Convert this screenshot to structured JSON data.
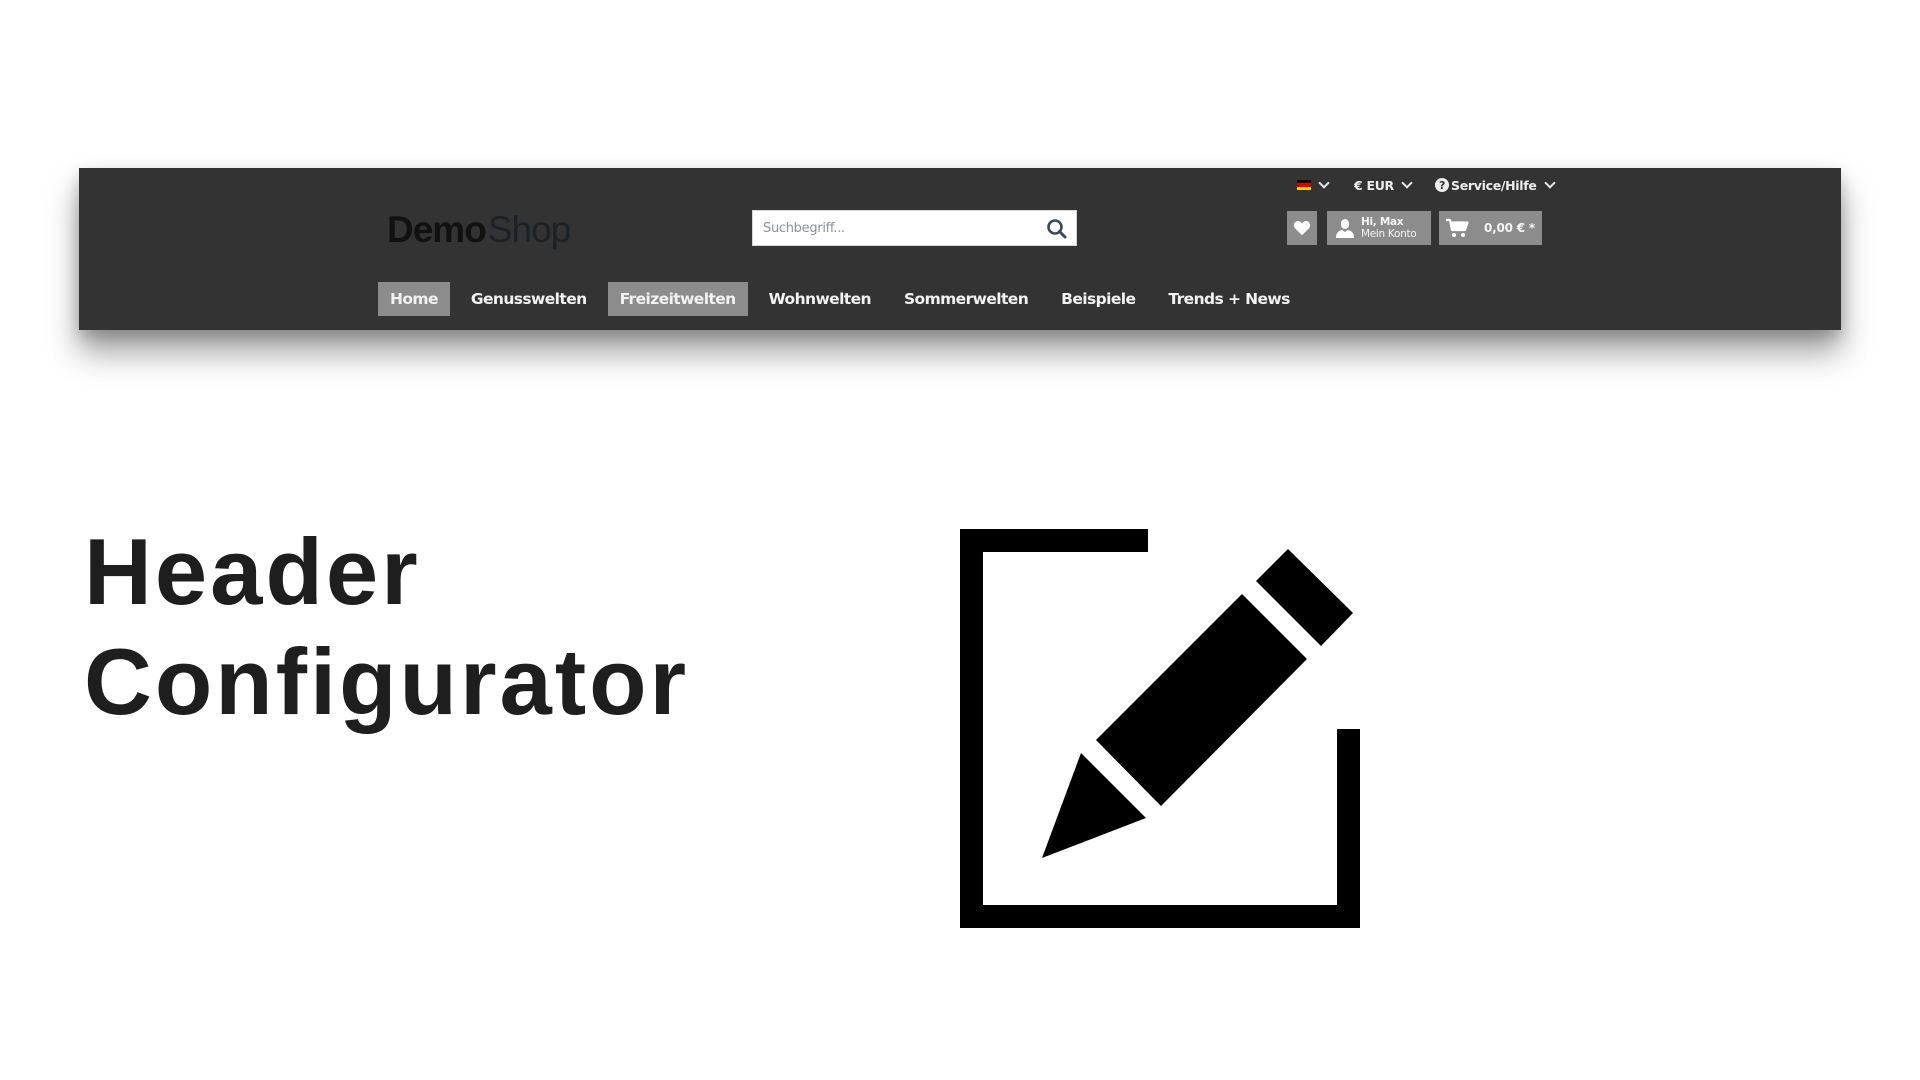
{
  "shop_header": {
    "topbar": {
      "language": {
        "icon": "german-flag-icon",
        "flag_colors": [
          "#000000",
          "#dd0000",
          "#ffce00"
        ]
      },
      "currency": {
        "label": "€ EUR"
      },
      "service": {
        "label": "Service/Hilfe",
        "icon": "question-circle-icon"
      }
    },
    "logo": {
      "bold": "Demo",
      "light": "Shop"
    },
    "search": {
      "placeholder": "Suchbegriff...",
      "value": ""
    },
    "actions": {
      "wishlist": {
        "icon": "heart-icon"
      },
      "account": {
        "line1": "Hi, Max",
        "line2": "Mein Konto",
        "icon": "user-icon"
      },
      "cart": {
        "amount": "0,00 € *",
        "icon": "cart-icon"
      }
    },
    "nav": [
      {
        "label": "Home",
        "active": true
      },
      {
        "label": "Genusswelten",
        "active": false
      },
      {
        "label": "Freizeitwelten",
        "active": true
      },
      {
        "label": "Wohnwelten",
        "active": false
      },
      {
        "label": "Sommerwelten",
        "active": false
      },
      {
        "label": "Beispiele",
        "active": false
      },
      {
        "label": "Trends + News",
        "active": false
      }
    ],
    "colors": {
      "background": "#333333",
      "highlight": "#8c8c8c",
      "text": "#f2f2f2"
    }
  },
  "hero": {
    "title_line1": "Header",
    "title_line2": "Configurator",
    "icon": "edit-icon"
  }
}
